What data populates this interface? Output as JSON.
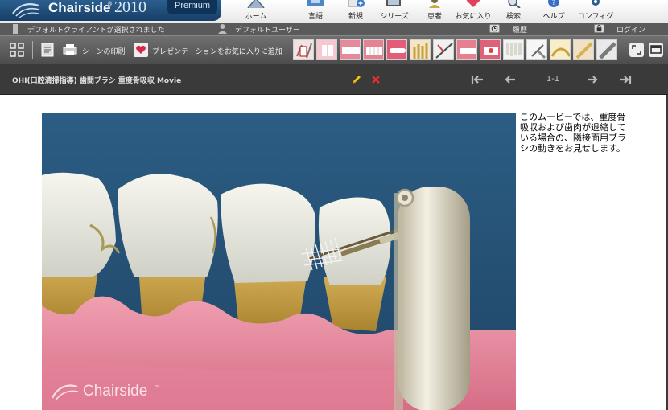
{
  "app": {
    "name": "Chairside",
    "trademark": "®",
    "year": "2010",
    "edition": "Premium"
  },
  "nav": {
    "items": [
      {
        "label": "ホーム",
        "icon": "home-icon"
      },
      {
        "label": "言語",
        "icon": "language-icon"
      },
      {
        "label": "新規",
        "icon": "new-icon"
      },
      {
        "label": "シリーズ",
        "icon": "series-icon"
      },
      {
        "label": "患者",
        "icon": "patient-icon"
      },
      {
        "label": "お気に入り",
        "icon": "favorites-icon"
      },
      {
        "label": "検索",
        "icon": "search-icon"
      },
      {
        "label": "ヘルプ",
        "icon": "help-icon"
      },
      {
        "label": "コンフィグ",
        "icon": "config-icon"
      }
    ]
  },
  "status": {
    "client_text": "デフォルトクライアントが選択されました",
    "user_text": "デフォルトユーザー",
    "history_label": "履歴",
    "login_label": "ログイン"
  },
  "toolbar": {
    "print_label": "シーンの印刷",
    "favorite_label": "プレゼンテーションをお気に入りに追加"
  },
  "breadcrumb": {
    "text": "OHI(口腔清掃指導) 歯間ブラシ 重度骨吸収 Movie"
  },
  "pager": {
    "count": "1-1"
  },
  "content": {
    "description": "このムービーでは、重度骨吸収および歯肉が退縮している場合の、隣接面用ブラシの動きをお見せします。",
    "watermark": "Chairside",
    "watermark_tm": "™"
  },
  "colors": {
    "brand_blue": "#1f4e7a",
    "scene_background": "#2f5d80",
    "gum_pink": "#e98aa0",
    "tooth_white": "#eeeee6",
    "root_gold": "#c9a24a",
    "edit_icon": "#f0c800",
    "delete_icon": "#e03030"
  }
}
